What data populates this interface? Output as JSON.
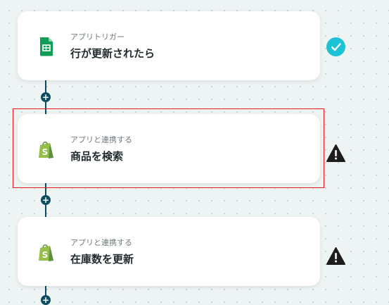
{
  "steps": [
    {
      "subtitle": "アプリトリガー",
      "title": "行が更新されたら",
      "app_icon": "google-sheets-icon",
      "status": "check-icon"
    },
    {
      "subtitle": "アプリと連携する",
      "title": "商品を検索",
      "app_icon": "shopify-icon",
      "status": "warning-icon"
    },
    {
      "subtitle": "アプリと連携する",
      "title": "在庫数を更新",
      "app_icon": "shopify-icon",
      "status": "warning-icon"
    }
  ],
  "connectors": {
    "add_label": "+"
  },
  "colors": {
    "connector": "#0f4c5f",
    "check": "#1cc3d6",
    "warning": "#1d1d1d",
    "highlight": "#e8161c",
    "sheets_green": "#0f9d58",
    "shopify_green": "#95bf47"
  }
}
